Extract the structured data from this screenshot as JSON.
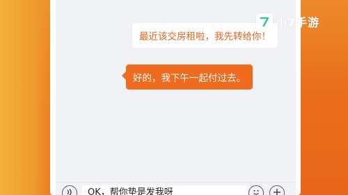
{
  "watermark": {
    "brand_text": "小7手游",
    "badge_glyph": "7",
    "badge_color": "#2ec8a6"
  },
  "chat": {
    "outgoing_message": "最近该交房租啦，我先转给你！",
    "incoming_message": "好的，我下午一起付过去。"
  },
  "composer": {
    "voice_icon": "voice-icon",
    "input_text": "OK，帮你垫是发我呀",
    "emoji_icon": "emoji-icon",
    "add_icon": "plus-icon"
  },
  "colors": {
    "background_orange": "#e8651a",
    "accent_orange": "#f06b1e",
    "chat_bg": "#f1f2f6"
  }
}
